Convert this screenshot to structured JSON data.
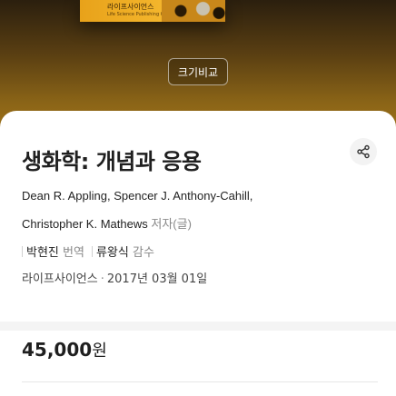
{
  "hero": {
    "cover_publisher": "라이프사이언스",
    "cover_sub": "Life Science Publishing Co.",
    "compare_label": "크기비교"
  },
  "book": {
    "title": "생화학: 개념과 응용",
    "authors": [
      "Dean R. Appling",
      "Spencer J. Anthony-Cahill",
      "Christopher K. Mathews"
    ],
    "authors_sep": ",",
    "author_role": "저자(글)",
    "translator": "박현진",
    "translator_role": "번역",
    "supervisor": "류왕식",
    "supervisor_role": "감수",
    "publisher": "라이프사이언스",
    "publish_date": "2017년 03월 01일"
  },
  "price": {
    "amount": "45,000",
    "unit": "원"
  },
  "icons": {
    "share": "share-icon"
  }
}
